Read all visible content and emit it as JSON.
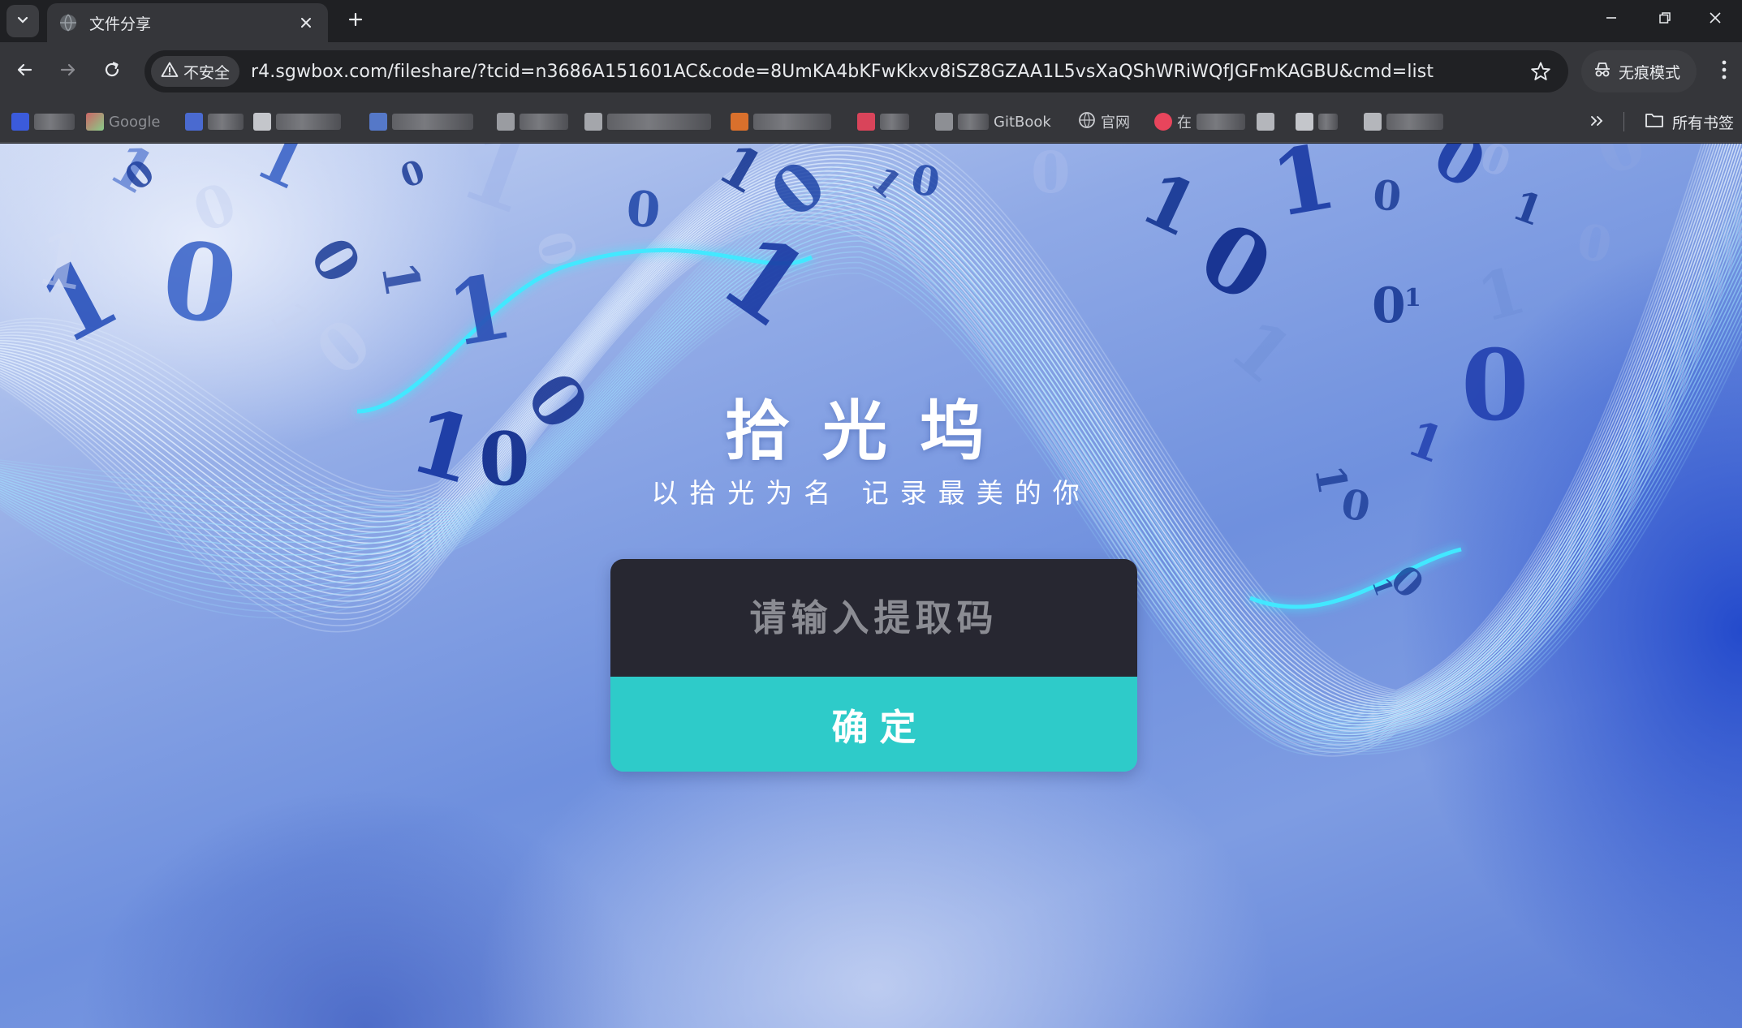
{
  "browser": {
    "tab": {
      "title": "文件分享",
      "favicon": "globe-icon"
    },
    "address": {
      "security_label": "不安全",
      "url": "r4.sgwbox.com/fileshare/?tcid=n3686A151601AC&code=8UmKA4bKFwKkxv8iSZ8GZAA1L5vsXaQShWRiWQfJGFmKAGBU&cmd=list"
    },
    "incognito_label": "无痕模式",
    "bookmarks": [
      {
        "label": "",
        "icon": "baidu-icon"
      },
      {
        "label": "Google",
        "icon": "google-icon"
      },
      {
        "label": "",
        "icon": "bookmark-icon"
      },
      {
        "label": "",
        "icon": "bookmark-icon"
      },
      {
        "label": "",
        "icon": "bookmark-icon"
      },
      {
        "label": "",
        "icon": "bookmark-icon"
      },
      {
        "label": "",
        "icon": "bookmark-icon"
      },
      {
        "label": "",
        "icon": "bookmark-icon"
      },
      {
        "label": "",
        "icon": "bookmark-icon"
      },
      {
        "label": "GitBook",
        "icon": "bookmark-icon"
      },
      {
        "label": "官网",
        "icon": "globe-icon"
      },
      {
        "label": "在",
        "icon": "bookmark-icon"
      }
    ],
    "all_bookmarks_label": "所有书签"
  },
  "page": {
    "title": "拾光坞",
    "subtitle": "以拾光为名 记录最美的你",
    "code_input": {
      "placeholder": "请输入提取码",
      "value": ""
    },
    "confirm_label": "确定"
  },
  "colors": {
    "accent": "#2ecbc9",
    "input_bg": "#272731",
    "glow": "#43e8ff"
  }
}
